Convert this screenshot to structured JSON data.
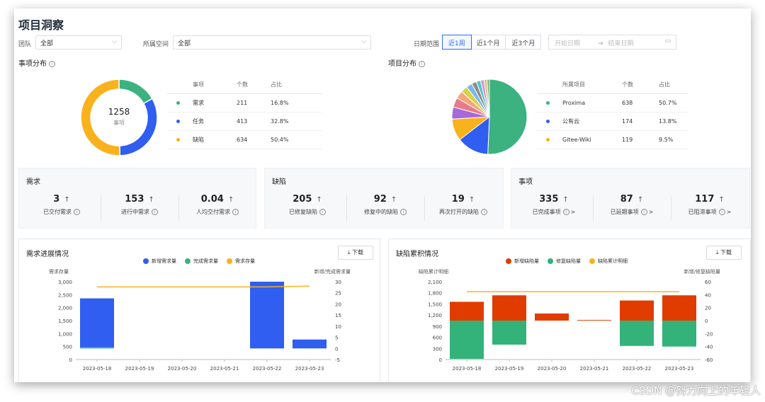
{
  "page": {
    "title": "项目洞察"
  },
  "filters": {
    "team_label": "团队",
    "team_value": "全部",
    "space_label": "所属空间",
    "space_value": "全部",
    "date_label": "日期范围",
    "ranges": [
      "近1周",
      "近1个月",
      "近3个月"
    ],
    "active_range": "近1周",
    "start_placeholder": "开始日期",
    "end_placeholder": "结束日期",
    "arrow": "→"
  },
  "issue_dist": {
    "title": "事项分布",
    "center_value": "1258",
    "center_label": "事项",
    "headers": [
      "事项",
      "个数",
      "占比"
    ],
    "rows": [
      {
        "name": "需求",
        "count": "211",
        "pct": "16.8%",
        "color": "#3bb27f"
      },
      {
        "name": "任务",
        "count": "413",
        "pct": "32.8%",
        "color": "#2f5ef0"
      },
      {
        "name": "缺陷",
        "count": "634",
        "pct": "50.4%",
        "color": "#f9b21c"
      }
    ]
  },
  "project_dist": {
    "title": "项目分布",
    "headers": [
      "所属项目",
      "个数",
      "占比"
    ],
    "rows": [
      {
        "name": "Proxima",
        "count": "638",
        "pct": "50.7%",
        "color": "#3bb27f"
      },
      {
        "name": "公有云",
        "count": "174",
        "pct": "13.8%",
        "color": "#2f5ef0"
      },
      {
        "name": "Gitee-Wiki",
        "count": "119",
        "pct": "9.5%",
        "color": "#f9b21c"
      }
    ]
  },
  "stats": {
    "demand": {
      "title": "需求",
      "items": [
        {
          "value": "3",
          "label": "已交付需求"
        },
        {
          "value": "153",
          "label": "进行中需求"
        },
        {
          "value": "0.04",
          "label": "人均交付需求"
        }
      ]
    },
    "defect": {
      "title": "缺陷",
      "items": [
        {
          "value": "205",
          "label": "已修复缺陷"
        },
        {
          "value": "92",
          "label": "修复中的缺陷"
        },
        {
          "value": "19",
          "label": "再次打开的缺陷"
        }
      ]
    },
    "issue": {
      "title": "事项",
      "items": [
        {
          "value": "335",
          "label": "已完成事项"
        },
        {
          "value": "87",
          "label": "已延期事项"
        },
        {
          "value": "117",
          "label": "已阻滞事项"
        }
      ]
    },
    "arrow": "↑",
    "gt": ">"
  },
  "download_label": "下载",
  "chart_data": [
    {
      "type": "bar",
      "title": "需求进展情况",
      "left_axis_label": "需求存量",
      "right_axis_label": "新增/完成需求量",
      "categories": [
        "2023-05-18",
        "2023-05-19",
        "2023-05-20",
        "2023-05-21",
        "2023-05-22",
        "2023-05-23"
      ],
      "left_ticks": [
        "3,000",
        "2,500",
        "2,000",
        "1,500",
        "1,000",
        "500",
        "0"
      ],
      "right_ticks": [
        "30",
        "25",
        "20",
        "15",
        "10",
        "5",
        "0",
        "-5"
      ],
      "series": [
        {
          "name": "新增需求量",
          "color": "#2f5ef0",
          "axis": "right",
          "values": [
            22,
            0,
            0,
            0,
            30,
            4
          ]
        },
        {
          "name": "完成需求量",
          "color": "#3bb27f",
          "axis": "right",
          "values": [
            0.5,
            0,
            0,
            0,
            0,
            0
          ]
        },
        {
          "name": "需求存量",
          "color": "#f9b21c",
          "axis": "left",
          "type": "line",
          "values": [
            2800,
            2800,
            2800,
            2800,
            2800,
            2830
          ]
        }
      ],
      "ylim_left": [
        0,
        3000
      ],
      "ylim_right": [
        -5,
        30
      ]
    },
    {
      "type": "bar",
      "title": "缺陷累积情况",
      "left_axis_label": "缺陷累计明细",
      "right_axis_label": "新增/修复缺陷量",
      "categories": [
        "2023-05-18",
        "2023-05-19",
        "2023-05-20",
        "2023-05-21",
        "2023-05-22",
        "2023-05-23"
      ],
      "left_ticks": [
        "2,100",
        "1,800",
        "1,500",
        "1,200",
        "900",
        "600",
        "300",
        "0"
      ],
      "right_ticks": [
        "60",
        "40",
        "20",
        "0",
        "-20",
        "-40",
        "-60"
      ],
      "series": [
        {
          "name": "新增缺陷量",
          "color": "#e03c00",
          "axis": "right",
          "values": [
            29,
            39,
            11,
            1,
            31,
            39
          ]
        },
        {
          "name": "修复缺陷量",
          "color": "#33b27a",
          "axis": "right",
          "values": [
            -59,
            -37,
            0,
            0,
            -39,
            -40
          ]
        },
        {
          "name": "缺陷累计明细",
          "color": "#f9b21c",
          "axis": "left",
          "type": "line",
          "values": [
            1830,
            1830,
            1830,
            1830,
            1830,
            1830
          ]
        }
      ],
      "ylim_left": [
        0,
        2100
      ],
      "ylim_right": [
        -60,
        60
      ]
    }
  ]
}
